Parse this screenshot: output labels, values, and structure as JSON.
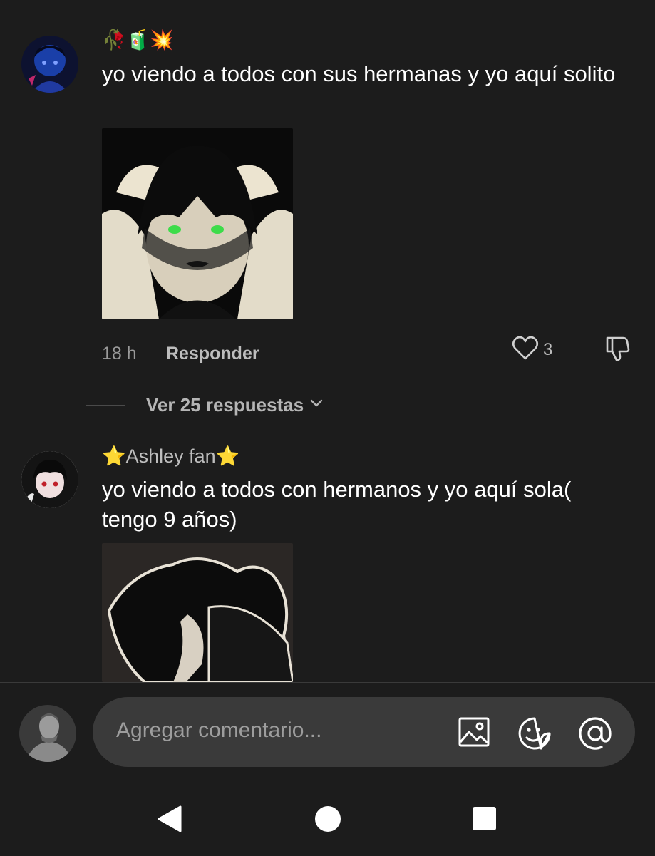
{
  "comments": [
    {
      "username": "🥀🧃💥",
      "text": "yo viendo a todos con sus hermanas y yo aquí solito",
      "time": "18 h",
      "reply_label": "Responder",
      "likes": "3",
      "view_replies": "Ver 25 respuestas"
    },
    {
      "username": "⭐Ashley fan⭐",
      "text": "yo viendo a todos con hermanos y yo aquí sola( tengo 9 años)"
    }
  ],
  "composer": {
    "placeholder": "Agregar comentario..."
  },
  "icons": {
    "like": "heart-outline-icon",
    "dislike": "thumbs-down-icon",
    "chevron": "chevron-down-icon",
    "image": "image-icon",
    "sticker": "emoji-sticker-icon",
    "mention": "at-icon",
    "back": "nav-back-icon",
    "home": "nav-home-icon",
    "recents": "nav-recents-icon"
  },
  "colors": {
    "background": "#1c1c1c",
    "input_background": "#3a3a3a",
    "muted_text": "#9a9a9a",
    "username_text": "#bdbdbd"
  }
}
